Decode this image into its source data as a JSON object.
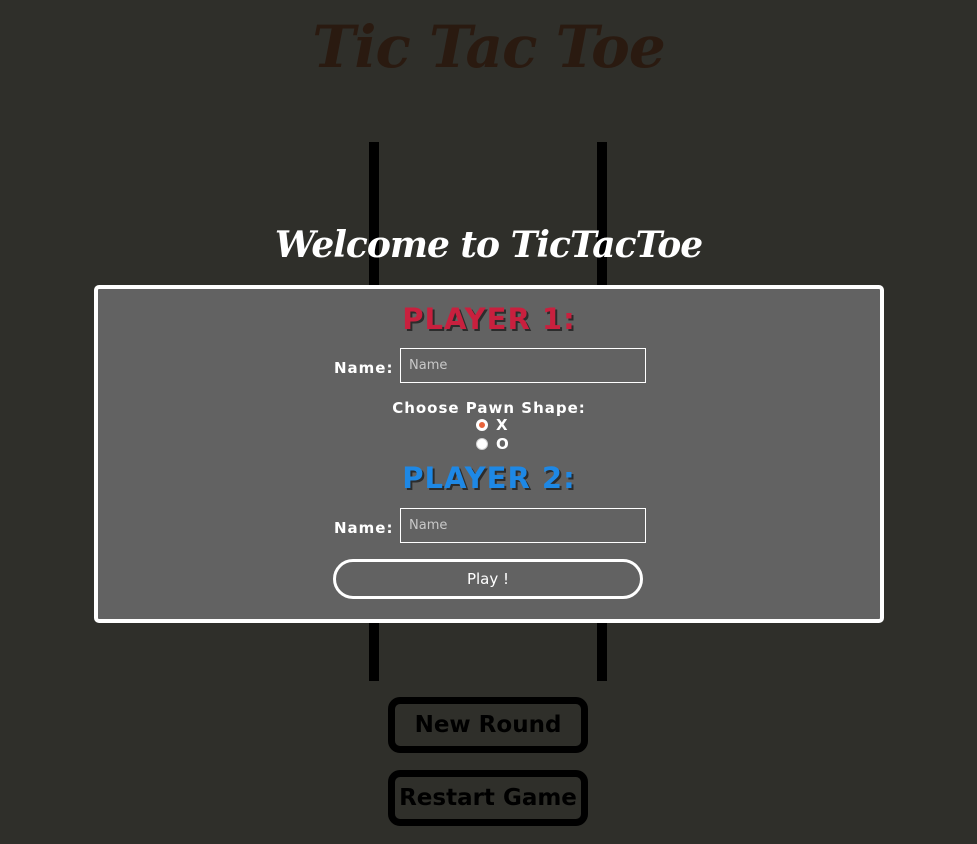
{
  "page": {
    "title": "Tic Tac Toe"
  },
  "board": {
    "line_color": "#000000"
  },
  "modal": {
    "welcome": "Welcome to TicTacToe",
    "player1": {
      "heading": "PLAYER 1:",
      "color": "#c8203e",
      "name_label": "Name:",
      "name_value": "",
      "name_placeholder": "Name"
    },
    "pawn": {
      "label": "Choose Pawn Shape:",
      "options": [
        {
          "label": "X",
          "checked": true
        },
        {
          "label": "O",
          "checked": false
        }
      ]
    },
    "player2": {
      "heading": "PLAYER 2:",
      "color": "#1e88e5",
      "name_label": "Name:",
      "name_value": "",
      "name_placeholder": "Name"
    },
    "play_label": "Play !"
  },
  "controls": {
    "new_round_label": "New Round",
    "restart_label": "Restart Game"
  },
  "colors": {
    "background": "#2f2f2a",
    "title": "#2a1a10",
    "modal_bg": "#626262",
    "radio_checked": "#e8643c"
  }
}
